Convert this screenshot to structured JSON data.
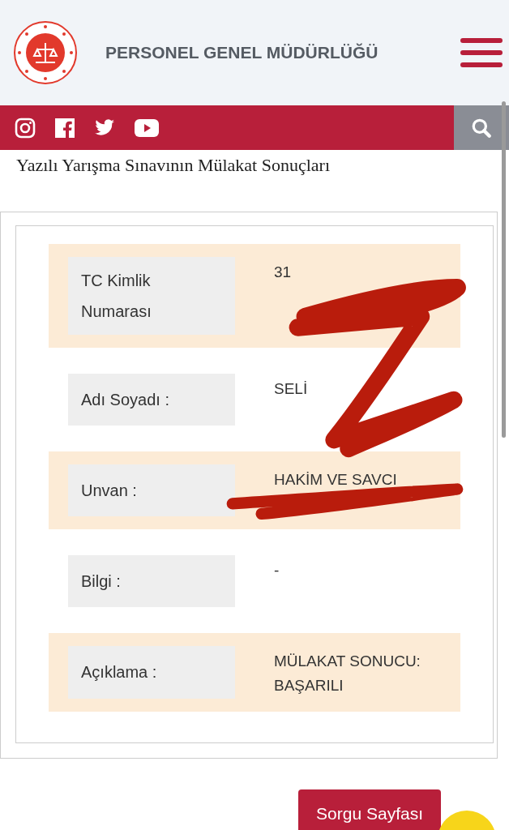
{
  "header": {
    "title": "PERSONEL GENEL MÜDÜRLÜĞÜ"
  },
  "social_bar": {
    "icons": [
      {
        "kind": "instagram"
      },
      {
        "kind": "facebook"
      },
      {
        "kind": "twitter"
      },
      {
        "kind": "youtube"
      }
    ]
  },
  "page_title": "Yazılı Yarışma Sınavının Mülakat Sonuçları",
  "rows": [
    {
      "label": "TC Kimlik Numarası",
      "value": "31",
      "shaded": true
    },
    {
      "label": "Adı Soyadı :",
      "value": "SELİ",
      "shaded": false
    },
    {
      "label": "Unvan :",
      "value": "HAKİM VE SAVCI",
      "shaded": true
    },
    {
      "label": "Bilgi :",
      "value": "-",
      "shaded": false
    },
    {
      "label": "Açıklama :",
      "value": "MÜLAKAT SONUCU: BAŞARILI",
      "shaded": true
    }
  ],
  "button": "Sorgu Sayfası"
}
